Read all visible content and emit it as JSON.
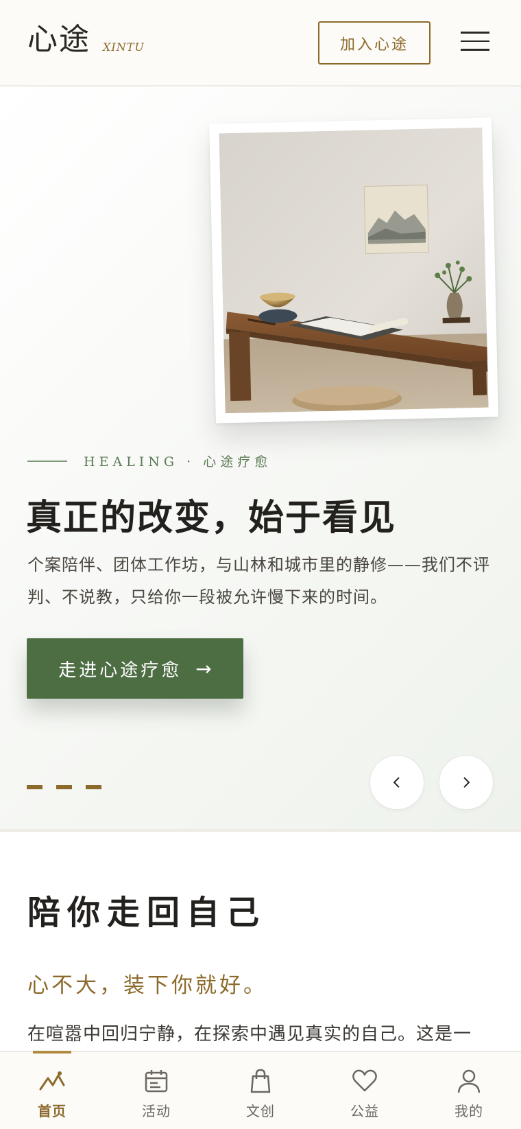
{
  "header": {
    "brand_cn": "心途",
    "brand_en": "XINTU",
    "join_label": "加入心途"
  },
  "hero": {
    "eyebrow": "HEALING · 心途疗愈",
    "title": "真正的改变，始于看见",
    "description": "个案陪伴、团体工作坊，与山林和城市里的静修——我们不评判、不说教，只给你一段被允许慢下来的时间。",
    "cta_label": "走进心途疗愈",
    "cta_arrow": "→",
    "slide_count": 3
  },
  "about": {
    "title": "陪你走回自己",
    "subtitle": "心不大，装下你就好。",
    "body": "在喧嚣中回归宁静，在探索中遇见真实的自己。这是一"
  },
  "tabbar": {
    "items": [
      {
        "label": "首页",
        "icon": "mountain-icon",
        "active": true
      },
      {
        "label": "活动",
        "icon": "calendar-icon",
        "active": false
      },
      {
        "label": "文创",
        "icon": "shopping-bag-icon",
        "active": false
      },
      {
        "label": "公益",
        "icon": "heart-icon",
        "active": false
      },
      {
        "label": "我的",
        "icon": "user-icon",
        "active": false
      }
    ]
  },
  "colors": {
    "accent_gold": "#8c6a2b",
    "accent_green": "#4d6d43",
    "eyebrow_green": "#5c7a55"
  }
}
